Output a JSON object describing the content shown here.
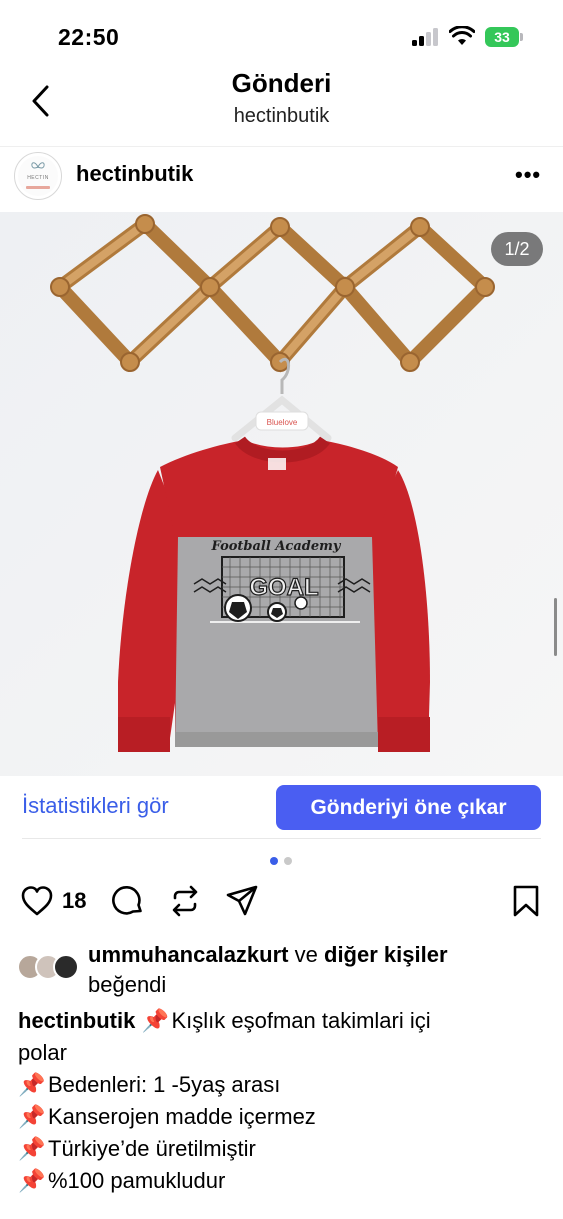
{
  "status_bar": {
    "time": "22:50",
    "battery": "33"
  },
  "nav": {
    "title": "Gönderi",
    "subtitle": "hectinbutik"
  },
  "post_header": {
    "username": "hectinbutik",
    "avatar_text": "HECTIN",
    "more": "•••"
  },
  "media": {
    "counter": "1/2",
    "print_title": "Football Academy",
    "print_word": "GOAL",
    "hanger_tag": "Bluelove"
  },
  "owner_actions": {
    "stats_label": "İstatistikleri gör",
    "promote_label": "Gönderiyi öne çıkar"
  },
  "engagement": {
    "like_count": "18"
  },
  "likes": {
    "user": "ummuhancalazkurt",
    "and": "ve",
    "others": "diğer kişiler",
    "suffix": "beğendi"
  },
  "caption": {
    "author": "hectinbutik",
    "pin": "📌",
    "first_line": "Kışlık eşofman takimlari içi",
    "first_line_cont": "polar",
    "lines": [
      "Bedenleri: 1 -5yaş arası",
      "Kanserojen madde içermez",
      "Türkiye’de üretilmiştir",
      "%100 pamukludur"
    ]
  },
  "colors": {
    "accent_blue": "#4a5ef2",
    "link_blue": "#3a5ee8",
    "battery_green": "#34c759",
    "sweater_red": "#c8242a",
    "sweater_grey": "#a9a9ab"
  }
}
